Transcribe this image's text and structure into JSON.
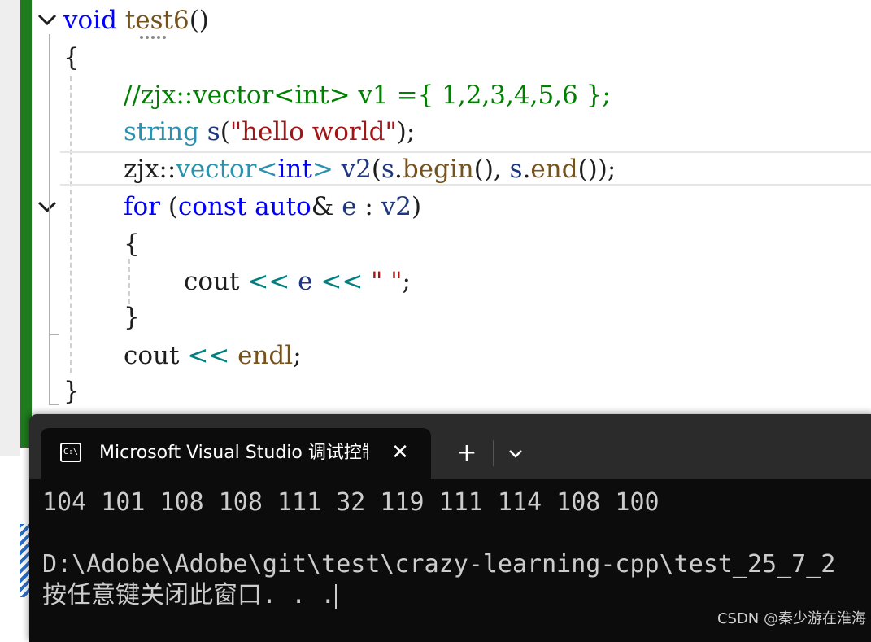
{
  "editor": {
    "line1": {
      "kw": "void",
      "fn": "test6",
      "rest": "()"
    },
    "line2": {
      "text": "{"
    },
    "line3": {
      "comment": "//zjx::vector<int> v1 ={ 1,2,3,4,5,6 };"
    },
    "line4": {
      "ty": "string",
      "va": "s",
      "open": "(",
      "str": "\"hello world\"",
      "close": ");"
    },
    "line5": {
      "ns": "zjx::",
      "ty1": "vector",
      "lt": "<",
      "kw": "int",
      "gt": ">",
      "va": "v2",
      "p1": "(",
      "va2": "s",
      "dot1": ".",
      "fn1": "begin",
      "p2": "(), ",
      "va3": "s",
      "dot2": ".",
      "fn2": "end",
      "p3": "());"
    },
    "line6": {
      "kw1": "for",
      "p1": "(",
      "kw2": "const",
      "kw3": "auto",
      "amp": "&",
      "va1": "e",
      "colon": ":",
      "va2": "v2",
      "p2": ")"
    },
    "line7": {
      "text": "{"
    },
    "line8": {
      "pl": "cout",
      "op1": "<<",
      "va": "e",
      "op2": "<<",
      "str": "\" \"",
      "semi": ";"
    },
    "line9": {
      "text": "}"
    },
    "line10": {
      "pl": "cout",
      "op": "<<",
      "fn": "endl",
      "semi": ";"
    },
    "line11": {
      "text": "}"
    }
  },
  "terminal": {
    "tab_title": "Microsoft Visual Studio 调试控制台",
    "tab_icon": "C:\\",
    "close_glyph": "✕",
    "new_tab_glyph": "+",
    "lines": [
      "104 101 108 108 111 32 119 111 114 108 100",
      "",
      "D:\\Adobe\\Adobe\\git\\test\\crazy-learning-cpp\\test_25_7_2",
      "按任意键关闭此窗口. . ."
    ]
  },
  "watermark": "CSDN @秦少游在淮海",
  "colors": {
    "keyword": "#0000ff",
    "type": "#2b91af",
    "function": "#74531f",
    "string": "#a31515",
    "comment": "#008000",
    "variable": "#1f377f",
    "operator": "#008080",
    "change_bar": "#1e7b1e",
    "terminal_bg": "#0c0c0c"
  }
}
